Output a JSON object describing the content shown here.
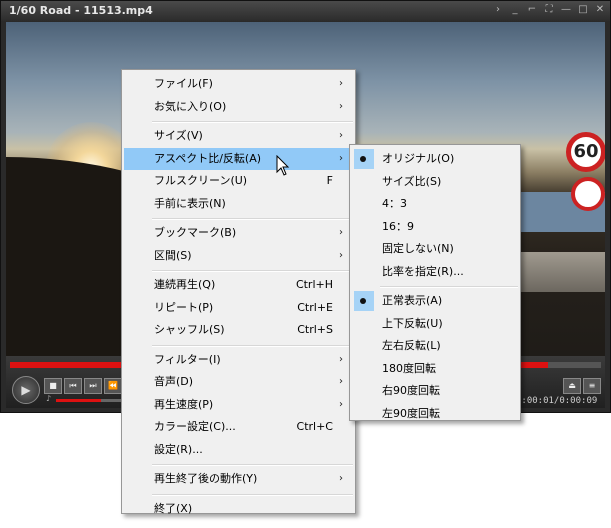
{
  "window": {
    "title": "1/60 Road - 11513.mp4",
    "controls": [
      ">",
      "_",
      "⌐",
      "⛶",
      "—",
      "□",
      "✕"
    ]
  },
  "video": {
    "sign_text": "60"
  },
  "player": {
    "time": "0:00:01/0:00:09"
  },
  "main_menu": [
    {
      "label": "ファイル(F)",
      "submenu": true
    },
    {
      "label": "お気に入り(O)",
      "submenu": true
    },
    {
      "separator": true
    },
    {
      "label": "サイズ(V)",
      "submenu": true
    },
    {
      "label": "アスペクト比/反転(A)",
      "submenu": true,
      "highlighted": true
    },
    {
      "label": "フルスクリーン(U)",
      "shortcut": "F"
    },
    {
      "label": "手前に表示(N)"
    },
    {
      "separator": true
    },
    {
      "label": "ブックマーク(B)",
      "submenu": true
    },
    {
      "label": "区間(S)",
      "submenu": true
    },
    {
      "separator": true
    },
    {
      "label": "連続再生(Q)",
      "shortcut": "Ctrl+H"
    },
    {
      "label": "リピート(P)",
      "shortcut": "Ctrl+E"
    },
    {
      "label": "シャッフル(S)",
      "shortcut": "Ctrl+S"
    },
    {
      "separator": true
    },
    {
      "label": "フィルター(I)",
      "submenu": true
    },
    {
      "label": "音声(D)",
      "submenu": true
    },
    {
      "label": "再生速度(P)",
      "submenu": true
    },
    {
      "label": "カラー設定(C)...",
      "shortcut": "Ctrl+C"
    },
    {
      "label": "設定(R)..."
    },
    {
      "separator": true
    },
    {
      "label": "再生終了後の動作(Y)",
      "submenu": true
    },
    {
      "separator": true
    },
    {
      "label": "終了(X)"
    }
  ],
  "sub_menu": [
    {
      "label": "オリジナル(O)",
      "checked": true
    },
    {
      "label": "サイズ比(S)"
    },
    {
      "label": "4：3"
    },
    {
      "label": "16：9"
    },
    {
      "label": "固定しない(N)"
    },
    {
      "label": "比率を指定(R)..."
    },
    {
      "separator": true
    },
    {
      "label": "正常表示(A)",
      "checked": true
    },
    {
      "label": "上下反転(U)"
    },
    {
      "label": "左右反転(L)"
    },
    {
      "label": "180度回転"
    },
    {
      "label": "右90度回転"
    },
    {
      "label": "左90度回転"
    }
  ],
  "arrow_glyph": "›"
}
